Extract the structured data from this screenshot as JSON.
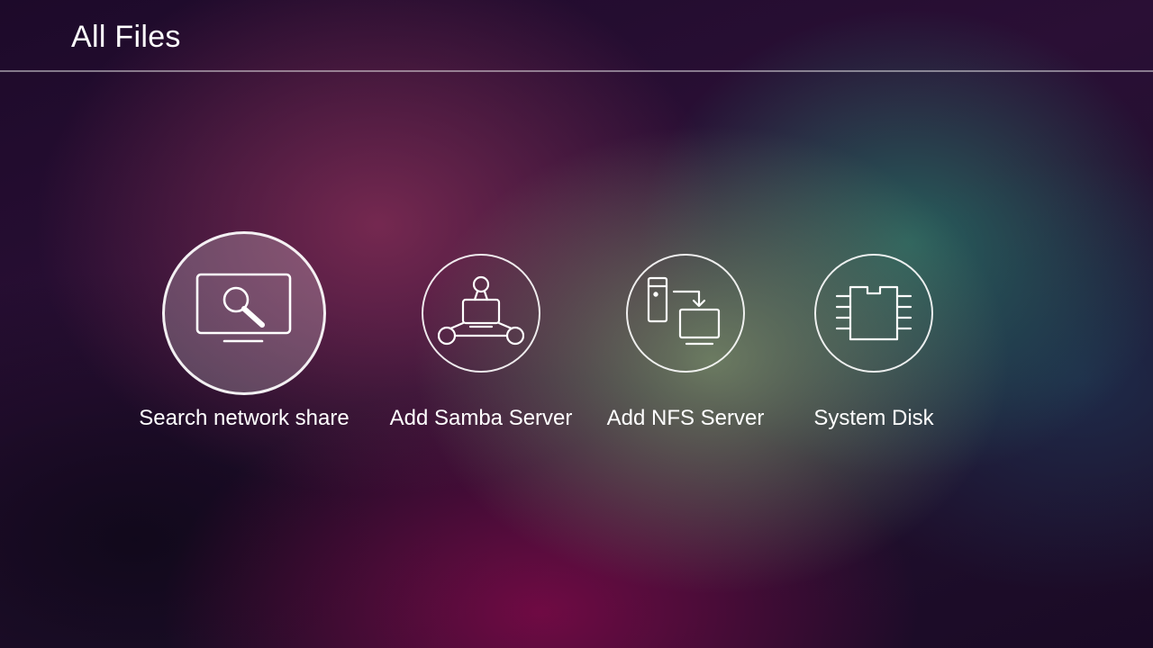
{
  "header": {
    "title": "All Files"
  },
  "items": [
    {
      "label": "Search network share",
      "icon": "monitor-search-icon",
      "focused": true
    },
    {
      "label": "Add Samba Server",
      "icon": "network-user-icon",
      "focused": false
    },
    {
      "label": "Add NFS Server",
      "icon": "server-transfer-icon",
      "focused": false
    },
    {
      "label": "System Disk",
      "icon": "chip-icon",
      "focused": false
    }
  ],
  "colors": {
    "text": "#ffffff",
    "divider": "#8a7f95",
    "focus_fill": "rgba(255,255,255,0.22)"
  }
}
